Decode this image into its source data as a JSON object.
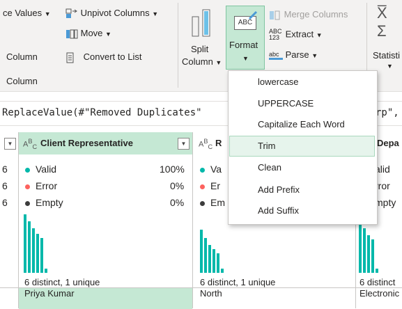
{
  "ribbon": {
    "values_label": "ce Values",
    "unpivot_label": "Unpivot Columns",
    "move_label": "Move",
    "column_label": "Column",
    "convert_label": "Convert to List",
    "group_label": "Column",
    "split_label_1": "Split",
    "split_label_2": "Column",
    "format_label": "Format",
    "merge_label": "Merge Columns",
    "extract_label": "Extract",
    "parse_label": "Parse",
    "stats_label": "Statisti",
    "abc_icon_text": "ABC",
    "abc123_top": "ABC",
    "abc123_bottom": "123",
    "parse_abc": "abc"
  },
  "formula": {
    "left_text": "ReplaceValue(#\"Removed Duplicates\"",
    "right_text": "rp\","
  },
  "columns": [
    {
      "type_icon": "A B C",
      "name": "Client Representative",
      "valid_label": "Valid",
      "valid_pct": "100%",
      "error_label": "Error",
      "error_pct": "0%",
      "empty_label": "Empty",
      "empty_pct": "0%",
      "distinct": "6 distinct, 1 unique",
      "cell": "Priya Kumar"
    },
    {
      "type_icon": "A B C",
      "name": "R",
      "valid_label": "Va",
      "error_label": "Er",
      "empty_label": "Em",
      "distinct": "6 distinct, 1 unique",
      "cell": "North"
    },
    {
      "name": "Depa",
      "valid_label": "alid",
      "error_label": "rror",
      "empty_label": "mpty",
      "distinct": "6 distinct",
      "cell": "Electronic"
    }
  ],
  "left_stub": {
    "p1": "6",
    "p2": "6",
    "p3": "6"
  },
  "menu": {
    "items": [
      "lowercase",
      "UPPERCASE",
      "Capitalize Each Word",
      "Trim",
      "Clean",
      "Add Prefix",
      "Add Suffix"
    ],
    "hovered_item": "Trim"
  },
  "colors": {
    "accent": "#01b8aa",
    "selected_header": "#c5e8d4",
    "valid_dot": "#01b8aa",
    "error_dot": "#fd625e",
    "empty_dot": "#3c3c3c"
  }
}
